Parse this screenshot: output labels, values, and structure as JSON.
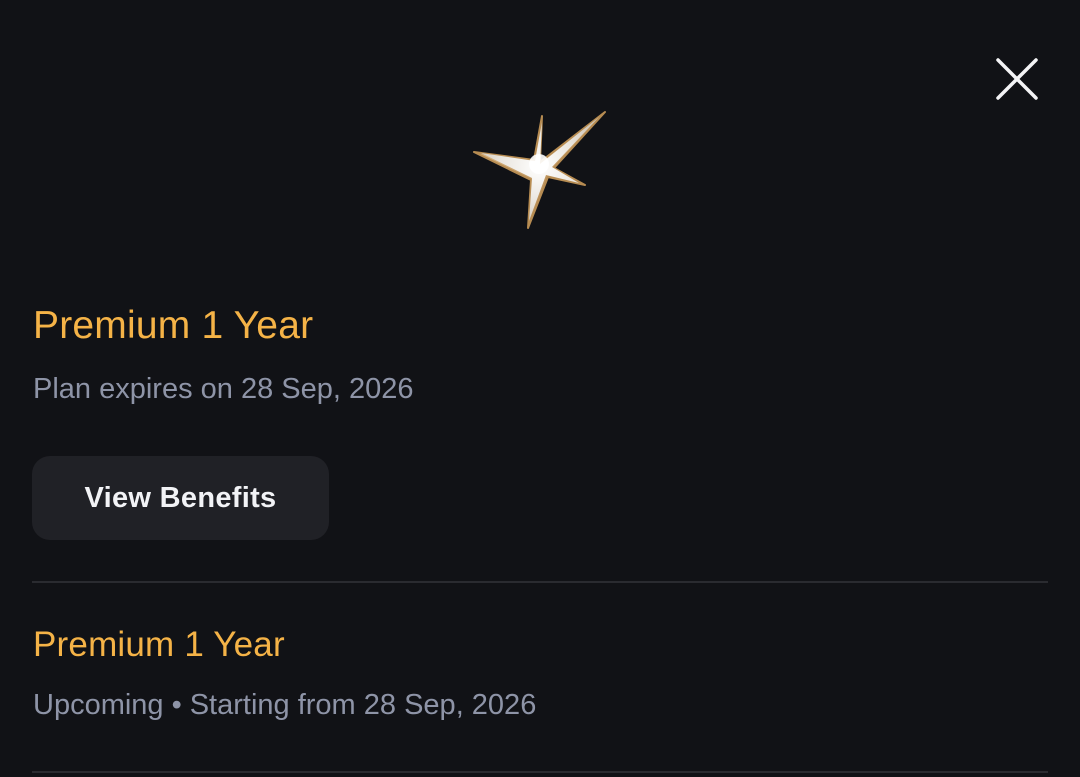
{
  "icons": {
    "close": "close-icon",
    "header": "sparkle-star-icon"
  },
  "colors": {
    "background": "#111216",
    "accent": "#F5B347",
    "muted_text": "#8E94A7",
    "button_bg": "#202126",
    "button_text": "#F2F3F6",
    "divider": "#2A2B30"
  },
  "current_plan": {
    "title": "Premium 1 Year",
    "subtitle": "Plan expires on 28 Sep, 2026",
    "action_label": "View Benefits"
  },
  "upcoming_plan": {
    "title": "Premium 1 Year",
    "status": "Upcoming",
    "separator": "•",
    "start_text": "Starting from 28 Sep, 2026"
  }
}
